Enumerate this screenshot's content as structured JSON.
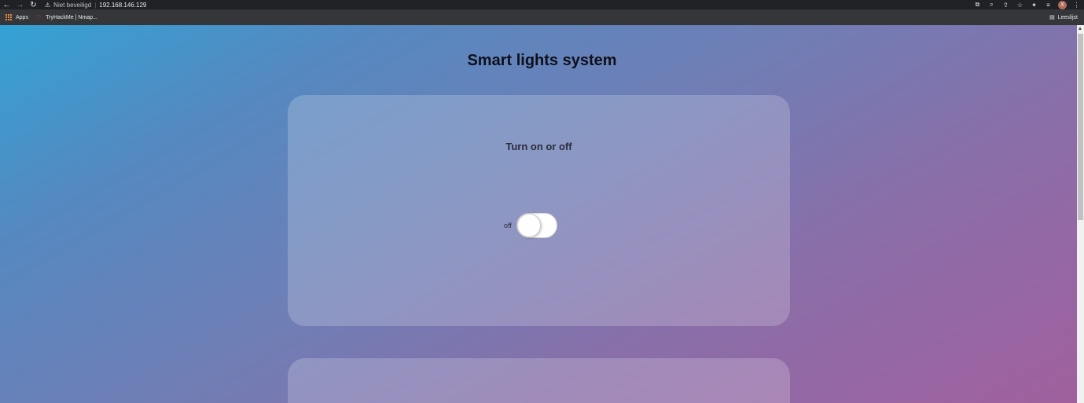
{
  "browser": {
    "security_label": "Niet beveiligd",
    "url": "192.168.146.129",
    "profile_initial": "X",
    "bookmarks": [
      {
        "label": "Apps"
      },
      {
        "label": "TryHackMe | Nmap..."
      }
    ],
    "reading_list_label": "Leeslijst"
  },
  "page": {
    "title": "Smart lights system",
    "card1": {
      "heading": "Turn on or off",
      "toggle_label": "off",
      "toggle_state": "off"
    }
  },
  "colors": {
    "gradient_start": "#33a2d4",
    "gradient_end": "#a0609e"
  }
}
